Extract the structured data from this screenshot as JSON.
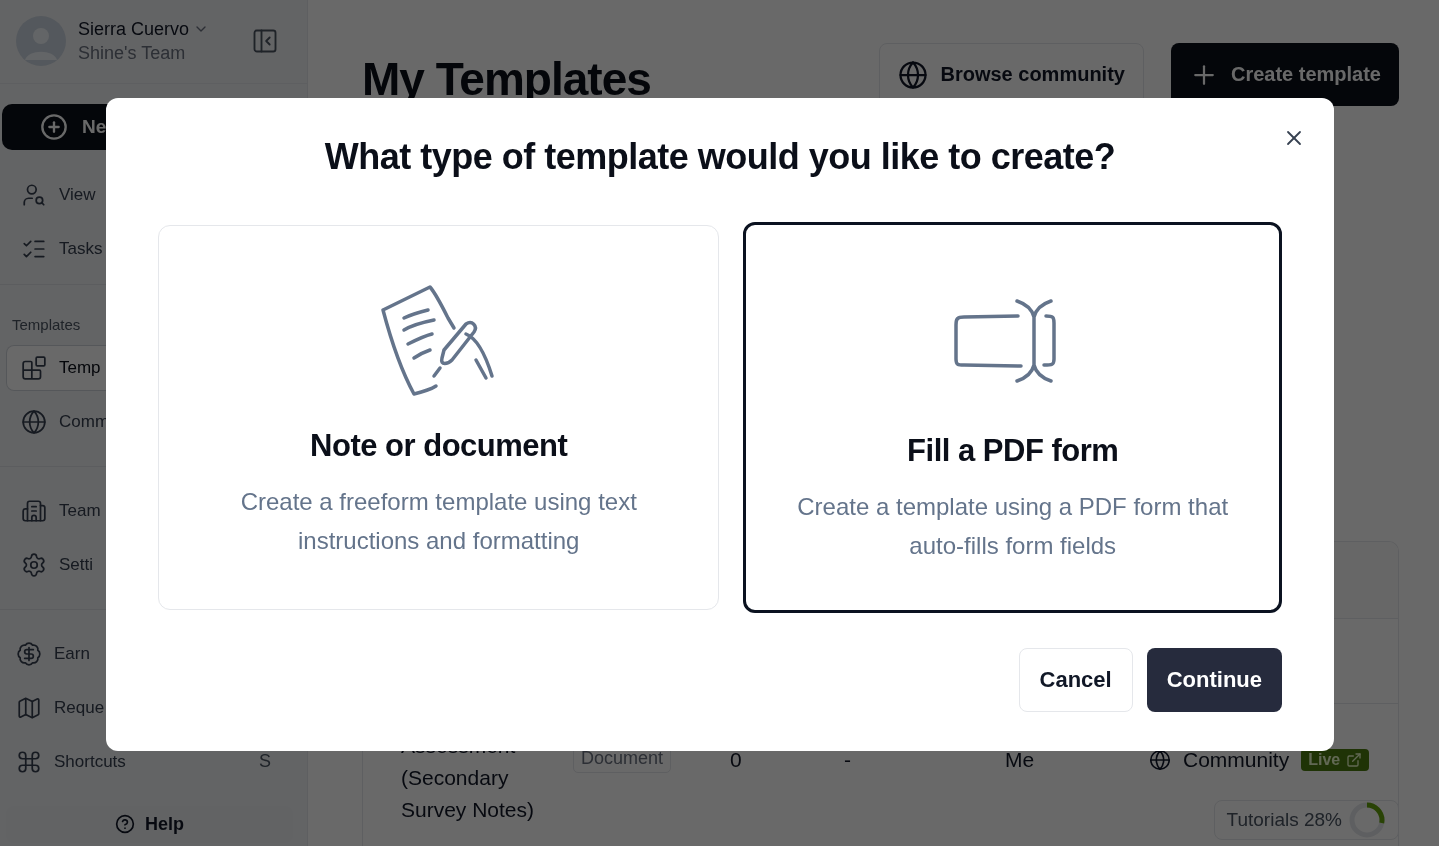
{
  "sidebar": {
    "user": {
      "name": "Sierra Cuervo",
      "team": "Shine's Team"
    },
    "new_button": "Ne",
    "groups": [
      {
        "items": [
          {
            "label": "View",
            "selected": false
          },
          {
            "label": "Tasks",
            "selected": false
          }
        ]
      },
      {
        "heading": "Templates",
        "items": [
          {
            "label": "Temp",
            "selected": true
          },
          {
            "label": "Comm",
            "selected": false
          }
        ]
      },
      {
        "items": [
          {
            "label": "Team",
            "selected": false
          },
          {
            "label": "Setti",
            "selected": false
          }
        ]
      },
      {
        "items": [
          {
            "label": "Earn",
            "selected": false
          },
          {
            "label": "Reque",
            "selected": false
          },
          {
            "label": "Shortcuts",
            "shortcut": "S",
            "selected": false
          }
        ]
      }
    ],
    "help_button": "Help"
  },
  "main": {
    "title": "My Templates",
    "buttons": [
      {
        "label": "Browse community",
        "kind": "outline"
      },
      {
        "label": "Create template",
        "kind": "primary"
      }
    ],
    "table": {
      "rows": [
        {
          "name": "Assessment (Secondary Survey Notes)",
          "type": "Document",
          "count": "0",
          "column_4": "-",
          "owner": "Me",
          "visibility": "Community",
          "status": "Live"
        }
      ]
    },
    "tutorials": {
      "label": "Tutorials 28%",
      "level": 0.28
    }
  },
  "dialog": {
    "title": "What type of template would you like to create?",
    "options": [
      {
        "title": "Note or document",
        "description": "Create a freeform template using text instructions and formatting",
        "selected": false
      },
      {
        "title": "Fill a PDF form",
        "description": "Create a template using a PDF form that auto-fills form fields",
        "selected": true
      }
    ],
    "buttons": [
      {
        "label": "Cancel",
        "kind": "secondary"
      },
      {
        "label": "Continue",
        "kind": "primary"
      }
    ]
  }
}
